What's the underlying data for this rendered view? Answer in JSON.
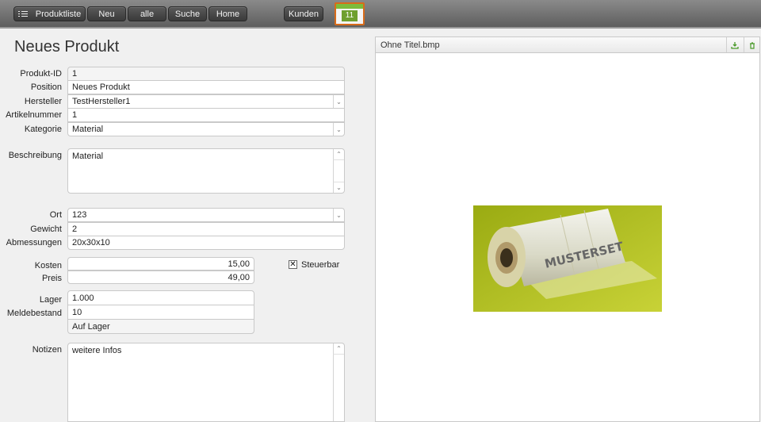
{
  "toolbar": {
    "produktliste": "Produktliste",
    "neu": "Neu",
    "alle": "alle",
    "suche": "Suche",
    "home": "Home",
    "kunden": "Kunden",
    "calendar_day": "11"
  },
  "page": {
    "title": "Neues Produkt"
  },
  "form": {
    "produkt_id": {
      "label": "Produkt-ID",
      "value": "1"
    },
    "position": {
      "label": "Position",
      "value": "Neues Produkt"
    },
    "hersteller": {
      "label": "Hersteller",
      "value": "TestHersteller1"
    },
    "artikelnummer": {
      "label": "Artikelnummer",
      "value": "1"
    },
    "kategorie": {
      "label": "Kategorie",
      "value": "Material"
    },
    "beschreibung": {
      "label": "Beschreibung",
      "value": "Material"
    },
    "ort": {
      "label": "Ort",
      "value": "123"
    },
    "gewicht": {
      "label": "Gewicht",
      "value": "2"
    },
    "abmessungen": {
      "label": "Abmessungen",
      "value": "20x30x10"
    },
    "kosten": {
      "label": "Kosten",
      "value": "15,00"
    },
    "preis": {
      "label": "Preis",
      "value": "49,00"
    },
    "steuerbar": {
      "label": "Steuerbar",
      "checked": true
    },
    "lager": {
      "label": "Lager",
      "value": "1.000"
    },
    "meldebestand": {
      "label": "Meldebestand",
      "value": "10"
    },
    "lager_status": "Auf Lager",
    "notizen": {
      "label": "Notizen",
      "value": "weitere Infos"
    }
  },
  "image_panel": {
    "filename": "Ohne Titel.bmp",
    "photo_text": "MUSTERSET",
    "icons": [
      "download-icon",
      "trash-icon"
    ]
  },
  "colors": {
    "accent_green": "#4a9a2a",
    "calendar_orange": "#d86b1a",
    "photo_bg": "#b7c322"
  }
}
